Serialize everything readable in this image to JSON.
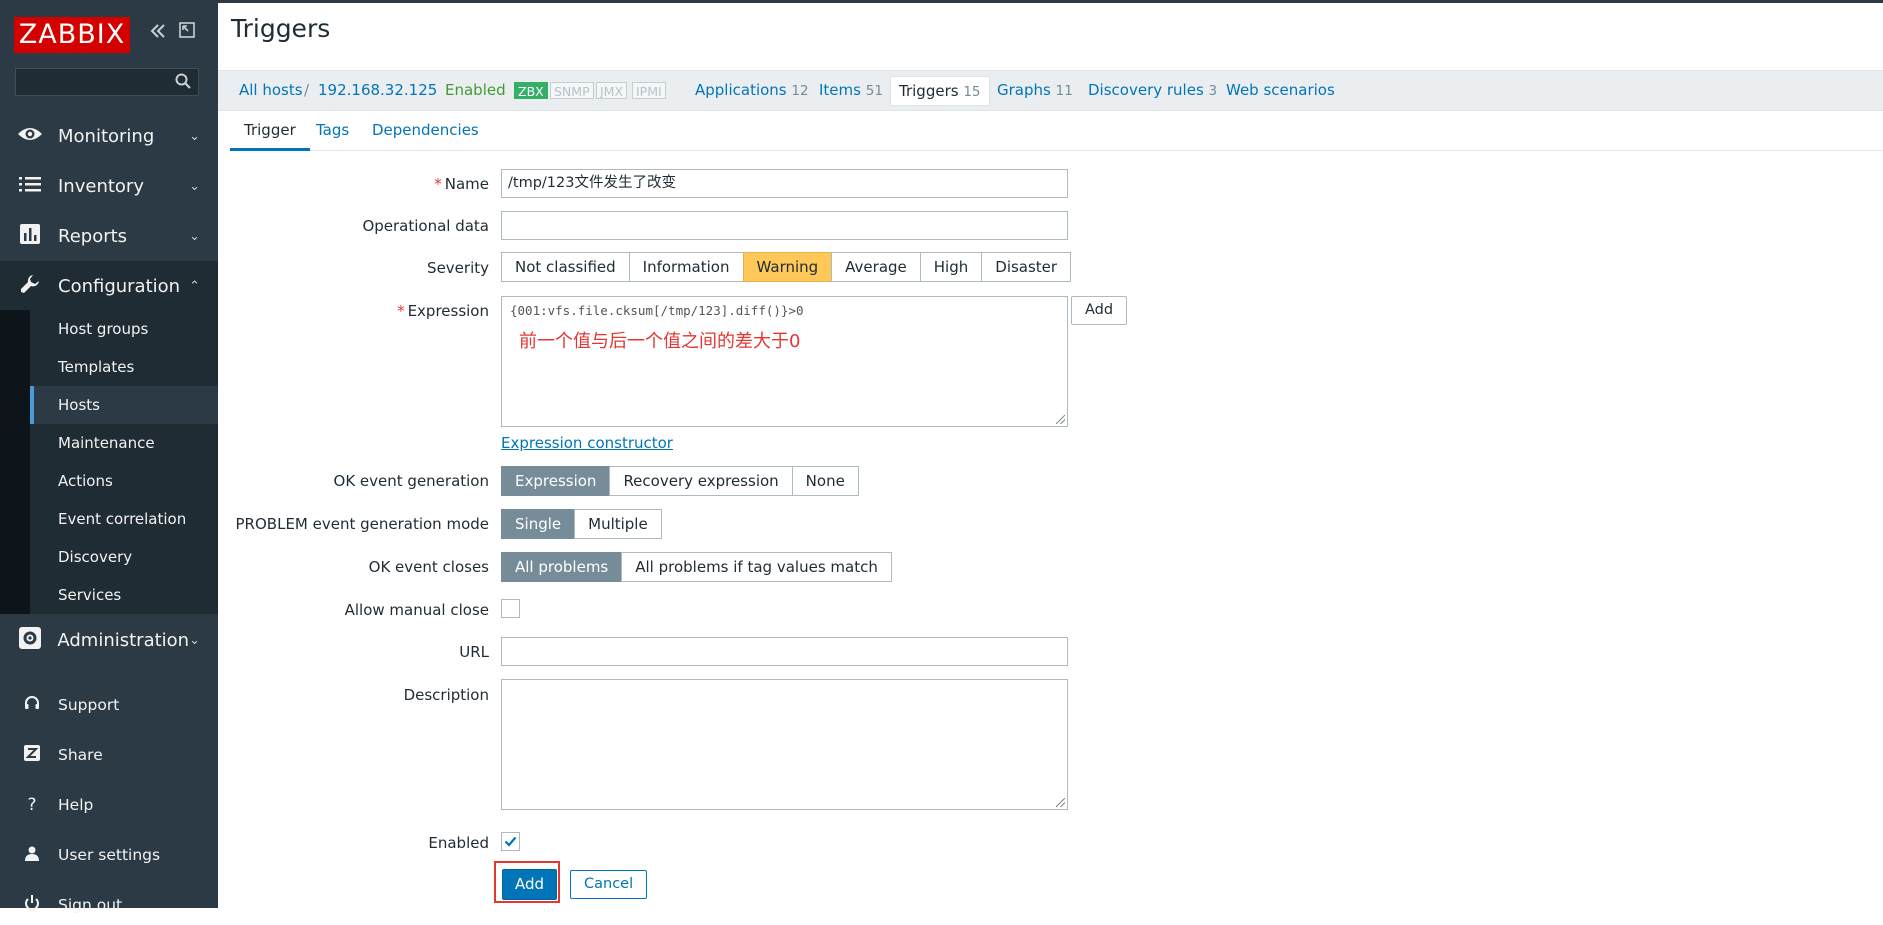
{
  "sidebar": {
    "logo": "ZABBIX",
    "collapse_icon": "double-chevron-left-icon",
    "kiosk_icon": "kiosk-mode-icon",
    "search": {
      "value": "",
      "placeholder": ""
    },
    "menus": [
      {
        "label": "Monitoring",
        "icon": "eye-icon"
      },
      {
        "label": "Inventory",
        "icon": "list-icon"
      },
      {
        "label": "Reports",
        "icon": "bar-chart-icon"
      },
      {
        "label": "Configuration",
        "icon": "wrench-icon"
      },
      {
        "label": "Administration",
        "icon": "gear-icon"
      }
    ],
    "config_items": [
      "Host groups",
      "Templates",
      "Hosts",
      "Maintenance",
      "Actions",
      "Event correlation",
      "Discovery",
      "Services"
    ],
    "utils": [
      {
        "label": "Support",
        "icon": "headset-icon"
      },
      {
        "label": "Share",
        "icon": "share-z-icon"
      },
      {
        "label": "Help",
        "icon": "question-icon"
      },
      {
        "label": "User settings",
        "icon": "user-icon"
      },
      {
        "label": "Sign out",
        "icon": "power-icon"
      }
    ]
  },
  "page": {
    "title": "Triggers"
  },
  "breadcrumb": {
    "all_hosts": "All hosts",
    "separator": "/",
    "host": "192.168.32.125",
    "status": "Enabled",
    "badges": [
      "ZBX",
      "SNMP",
      "JMX",
      "IPMI"
    ],
    "applications": {
      "label": "Applications",
      "count": "12"
    },
    "items": {
      "label": "Items",
      "count": "51"
    },
    "triggers": {
      "label": "Triggers",
      "count": "15"
    },
    "graphs": {
      "label": "Graphs",
      "count": "11"
    },
    "discovery": {
      "label": "Discovery rules",
      "count": "3"
    },
    "web": {
      "label": "Web scenarios"
    }
  },
  "tabs": [
    "Trigger",
    "Tags",
    "Dependencies"
  ],
  "form": {
    "name": {
      "label": "Name",
      "value": "/tmp/123文件发生了改变"
    },
    "opdata": {
      "label": "Operational data",
      "value": ""
    },
    "severity": {
      "label": "Severity",
      "options": [
        "Not classified",
        "Information",
        "Warning",
        "Average",
        "High",
        "Disaster"
      ],
      "selected": "Warning"
    },
    "expression": {
      "label": "Expression",
      "value": "{001:vfs.file.cksum[/tmp/123].diff()}>0",
      "annotation": "前一个值与后一个值之间的差大于0",
      "add_label": "Add",
      "constructor_link": "Expression constructor"
    },
    "ok_event_generation": {
      "label": "OK event generation",
      "options": [
        "Expression",
        "Recovery expression",
        "None"
      ],
      "selected": "Expression"
    },
    "problem_mode": {
      "label": "PROBLEM event generation mode",
      "options": [
        "Single",
        "Multiple"
      ],
      "selected": "Single"
    },
    "ok_event_closes": {
      "label": "OK event closes",
      "options": [
        "All problems",
        "All problems if tag values match"
      ],
      "selected": "All problems"
    },
    "manual_close": {
      "label": "Allow manual close",
      "checked": false
    },
    "url": {
      "label": "URL",
      "value": ""
    },
    "description": {
      "label": "Description",
      "value": ""
    },
    "enabled": {
      "label": "Enabled",
      "checked": true
    },
    "buttons": {
      "add": "Add",
      "cancel": "Cancel"
    }
  },
  "colors": {
    "sidebar": "#2b3a44",
    "link": "#0275b8",
    "warning": "#ffc859",
    "required": "#e33734",
    "annotation": "#e33734",
    "enabled": "#429a33"
  }
}
